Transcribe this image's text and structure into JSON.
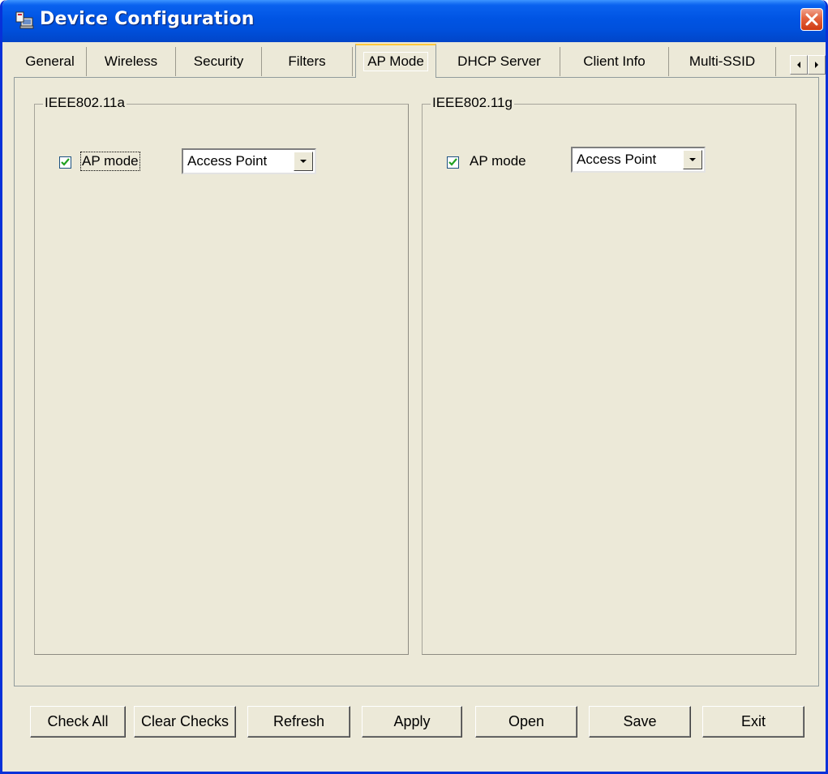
{
  "window": {
    "title": "Device Configuration"
  },
  "tabs": [
    {
      "label": "General"
    },
    {
      "label": "Wireless"
    },
    {
      "label": "Security"
    },
    {
      "label": "Filters"
    },
    {
      "label": "AP Mode",
      "active": true
    },
    {
      "label": "DHCP Server"
    },
    {
      "label": "Client Info"
    },
    {
      "label": "Multi-SSID"
    }
  ],
  "groups": {
    "ieee80211a": {
      "title": "IEEE802.11a",
      "ap_mode_label": "AP mode",
      "ap_mode_checked": true,
      "mode_value": "Access Point"
    },
    "ieee80211g": {
      "title": "IEEE802.11g",
      "ap_mode_label": "AP mode",
      "ap_mode_checked": true,
      "mode_value": "Access Point"
    }
  },
  "buttons": {
    "check_all": "Check All",
    "clear_checks": "Clear Checks",
    "refresh": "Refresh",
    "apply": "Apply",
    "open": "Open",
    "save": "Save",
    "exit": "Exit"
  },
  "colors": {
    "titlebar": "#0054e3",
    "window_face": "#ece9d8",
    "active_tab_highlight": "#ffc83c",
    "close_button": "#e3623c"
  },
  "icons": [
    "app-icon",
    "close-icon",
    "arrow-left-icon",
    "arrow-right-icon",
    "checkmark-icon",
    "dropdown-arrow-icon"
  ]
}
